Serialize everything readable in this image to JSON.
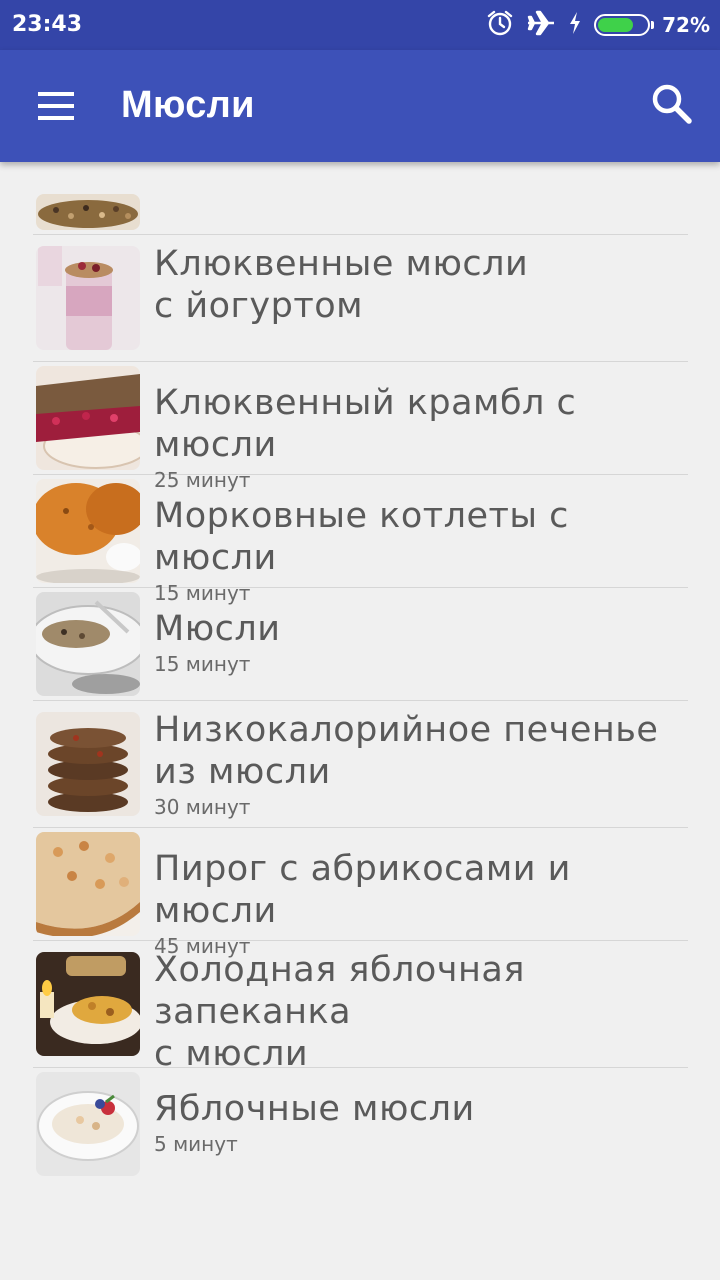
{
  "status_bar": {
    "time": "23:43",
    "battery_percent": "72%",
    "battery_level": 0.72,
    "icons": [
      "alarm-icon",
      "airplane-mode-icon",
      "charging-icon",
      "battery-icon"
    ],
    "battery_color": "#3fd14a"
  },
  "app_bar": {
    "title": "Мюсли",
    "menu_icon": "hamburger-menu-icon",
    "search_icon": "search-icon",
    "color": "#3d51b8"
  },
  "recipes": [
    {
      "title_line1": "",
      "title_line2": "",
      "time": "",
      "image": "muesli-bowl"
    },
    {
      "title_line1": "Клюквенные мюсли",
      "title_line2": "с йогуртом",
      "time": "",
      "image": "yogurt-parfait"
    },
    {
      "title_line1": "Клюквенный крамбл с мюсли",
      "title_line2": "",
      "time": "25 минут",
      "image": "cranberry-crumble"
    },
    {
      "title_line1": "Морковные котлеты с мюсли",
      "title_line2": "",
      "time": "15 минут",
      "image": "carrot-patties"
    },
    {
      "title_line1": "Мюсли",
      "title_line2": "",
      "time": "15 минут",
      "image": "muesli-plate"
    },
    {
      "title_line1": "Низкокалорийное печенье",
      "title_line2": "из мюсли",
      "time": "30 минут",
      "image": "cookies-stack"
    },
    {
      "title_line1": "Пирог с абрикосами и мюсли",
      "title_line2": "",
      "time": "45 минут",
      "image": "apricot-pie"
    },
    {
      "title_line1": "Холодная яблочная запеканка",
      "title_line2": "с мюсли",
      "time": "",
      "image": "apple-casserole"
    },
    {
      "title_line1": "Яблочные мюсли",
      "title_line2": "",
      "time": "5 минут",
      "image": "apple-muesli-bowl"
    }
  ]
}
